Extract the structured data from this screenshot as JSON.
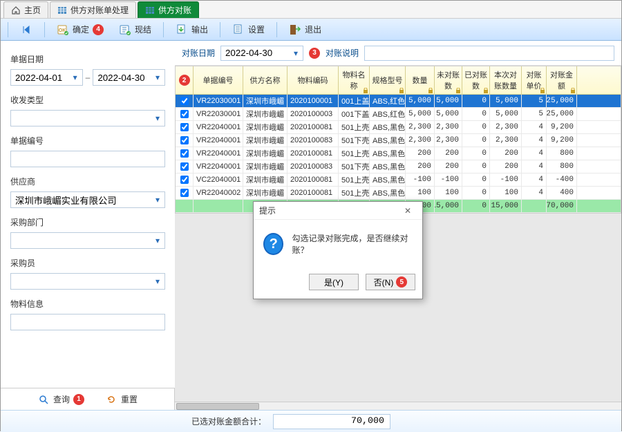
{
  "tabs": [
    {
      "label": "主页",
      "icon": "home"
    },
    {
      "label": "供方对账单处理",
      "icon": "grid"
    },
    {
      "label": "供方对账",
      "icon": "grid",
      "active": true
    }
  ],
  "toolbar": {
    "first": "",
    "confirm": "确定",
    "confirm_badge": "4",
    "settle": "现结",
    "export": "输出",
    "settings": "设置",
    "exit": "退出"
  },
  "sidebar": {
    "date_label": "单据日期",
    "date_from": "2022-04-01",
    "date_to": "2022-04-30",
    "type_label": "收发类型",
    "type_value": "",
    "docno_label": "单据编号",
    "docno_value": "",
    "supplier_label": "供应商",
    "supplier_value": "深圳市峨嵋实业有限公司",
    "dept_label": "采购部门",
    "dept_value": "",
    "buyer_label": "采购员",
    "buyer_value": "",
    "material_label": "物料信息",
    "material_value": "",
    "query": "查询",
    "query_badge": "1",
    "reset": "重置"
  },
  "filter": {
    "date_label": "对账日期",
    "date_value": "2022-04-30",
    "date_badge": "3",
    "desc_label": "对账说明",
    "desc_value": ""
  },
  "grid": {
    "chk_badge": "2",
    "headers": [
      "单据编号",
      "供方名称",
      "物料编码",
      "物料名称",
      "规格型号",
      "数量",
      "未对账数",
      "已对账数",
      "本次对账数量",
      "对账单价",
      "对账金额"
    ],
    "rows": [
      {
        "chk": true,
        "doc": "VR22030001",
        "sup": "深圳市峨嵋",
        "mat": "2020100001",
        "mn": "001上盖",
        "spec": "ABS,红色",
        "qty": "5,000",
        "un": "5,000",
        "rec": "0",
        "cur": "5,000",
        "price": "5",
        "amt": "25,000",
        "sel": true
      },
      {
        "chk": true,
        "doc": "VR22030001",
        "sup": "深圳市峨嵋",
        "mat": "2020100003",
        "mn": "001下盖",
        "spec": "ABS,红色",
        "qty": "5,000",
        "un": "5,000",
        "rec": "0",
        "cur": "5,000",
        "price": "5",
        "amt": "25,000"
      },
      {
        "chk": true,
        "doc": "VR22040001",
        "sup": "深圳市峨嵋",
        "mat": "2020100081",
        "mn": "501上壳",
        "spec": "ABS,黑色",
        "qty": "2,300",
        "un": "2,300",
        "rec": "0",
        "cur": "2,300",
        "price": "4",
        "amt": "9,200"
      },
      {
        "chk": true,
        "doc": "VR22040001",
        "sup": "深圳市峨嵋",
        "mat": "2020100083",
        "mn": "501下壳",
        "spec": "ABS,黑色",
        "qty": "2,300",
        "un": "2,300",
        "rec": "0",
        "cur": "2,300",
        "price": "4",
        "amt": "9,200"
      },
      {
        "chk": true,
        "doc": "VR22040001",
        "sup": "深圳市峨嵋",
        "mat": "2020100081",
        "mn": "501上壳",
        "spec": "ABS,黑色",
        "qty": "200",
        "un": "200",
        "rec": "0",
        "cur": "200",
        "price": "4",
        "amt": "800"
      },
      {
        "chk": true,
        "doc": "VR22040001",
        "sup": "深圳市峨嵋",
        "mat": "2020100083",
        "mn": "501下壳",
        "spec": "ABS,黑色",
        "qty": "200",
        "un": "200",
        "rec": "0",
        "cur": "200",
        "price": "4",
        "amt": "800"
      },
      {
        "chk": true,
        "doc": "VC22040001",
        "sup": "深圳市峨嵋",
        "mat": "2020100081",
        "mn": "501上壳",
        "spec": "ABS,黑色",
        "qty": "-100",
        "un": "-100",
        "rec": "0",
        "cur": "-100",
        "price": "4",
        "amt": "-400"
      },
      {
        "chk": true,
        "doc": "VR22040002",
        "sup": "深圳市峨嵋",
        "mat": "2020100081",
        "mn": "501上壳",
        "spec": "ABS,黑色",
        "qty": "100",
        "un": "100",
        "rec": "0",
        "cur": "100",
        "price": "4",
        "amt": "400"
      }
    ],
    "sum": {
      "qty": "15,000",
      "un": "15,000",
      "rec": "0",
      "cur": "15,000",
      "amt": "70,000"
    }
  },
  "status": {
    "label": "已选对账金额合计：",
    "value": "70,000"
  },
  "dialog": {
    "title": "提示",
    "message": "勾选记录对账完成，是否继续对账？",
    "yes": "是(Y)",
    "no": "否(N)",
    "no_badge": "5"
  }
}
